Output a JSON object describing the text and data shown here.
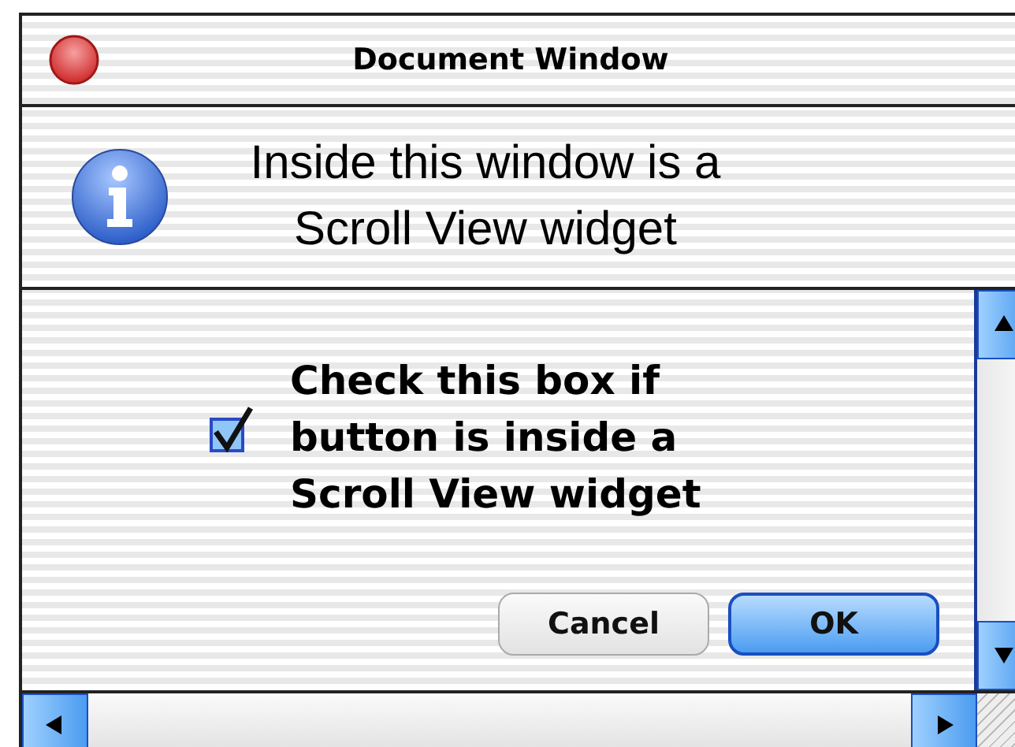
{
  "window": {
    "title": "Document Window"
  },
  "header": {
    "message": "Inside this window is a Scroll View widget"
  },
  "scroll_view": {
    "checkbox": {
      "label": "Check this box if button is inside a Scroll View widget",
      "checked": true
    },
    "buttons": [
      {
        "label": "Cancel",
        "kind": "secondary"
      },
      {
        "label": "OK",
        "kind": "default"
      }
    ]
  }
}
